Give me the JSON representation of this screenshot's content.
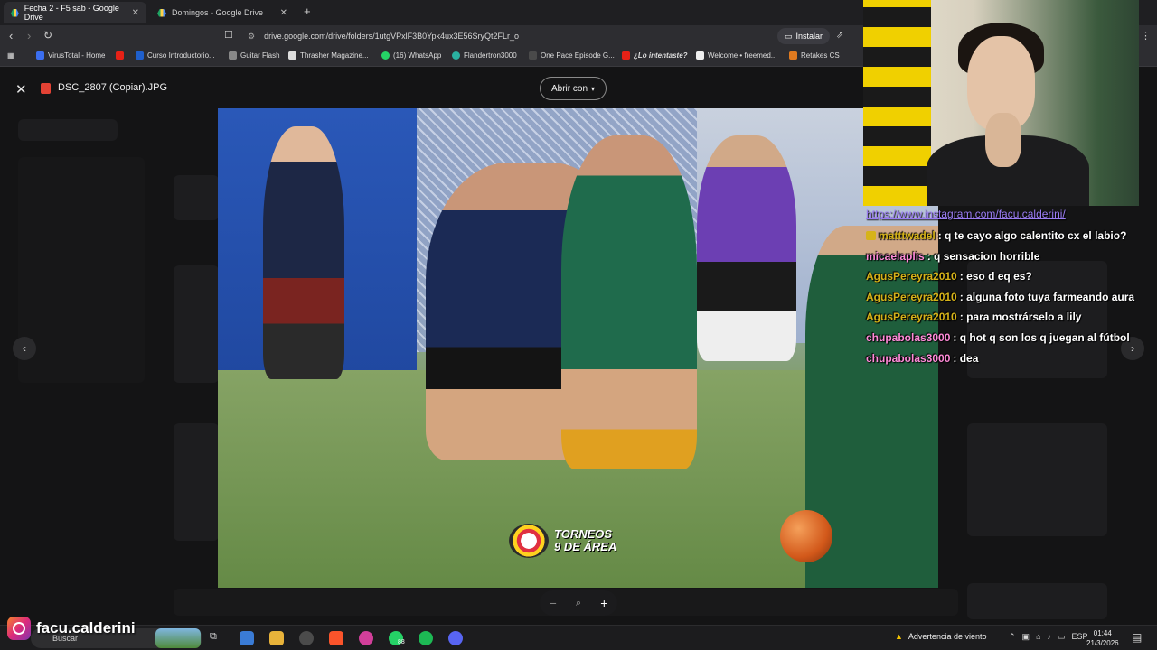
{
  "browser": {
    "tabs": [
      {
        "label": "Fecha 2 - F5 sab - Google Drive",
        "active": true
      },
      {
        "label": "Domingos - Google Drive",
        "active": false
      }
    ],
    "url": "drive.google.com/drive/folders/1utgVPxlF3B0Ypk4ux3E56SryQt2FLr_o",
    "install_label": "Instalar",
    "bookmarks": [
      "VirusTotal - Home",
      "Curso Introductorio...",
      "Guitar Flash",
      "Thrasher Magazine...",
      "(16) WhatsApp",
      "Flandertron3000",
      "One Pace Episode G...",
      "¿Lo intentaste?",
      "Welcome • freemed...",
      "Retakes CS"
    ]
  },
  "viewer": {
    "file_name": "DSC_2807 (Copiar).JPG",
    "open_with_label": "Abrir con",
    "photo_logo_text": [
      "TORNEOS",
      "9 DE ÁREA"
    ]
  },
  "chat": {
    "link": "https://www.instagram.com/facu.calderini/",
    "messages": [
      {
        "user": "matttwadel",
        "text": ": q te cayo algo calentito cx el labio?",
        "color": "#d6b319",
        "badge": true
      },
      {
        "user": "micaelaplis",
        "text": ": q sensacion horrible",
        "color": "#ff8ad8",
        "badge": false
      },
      {
        "user": "AgusPereyra2010",
        "text": ": eso d eq es?",
        "color": "#d6b319",
        "badge": false
      },
      {
        "user": "AgusPereyra2010",
        "text": ": alguna foto tuya farmeando aura",
        "color": "#d6b319",
        "badge": false
      },
      {
        "user": "AgusPereyra2010",
        "text": ": para mostrárselo a lily",
        "color": "#d6b319",
        "badge": false
      },
      {
        "user": "chupabolas3000",
        "text": ": q hot q son los q juegan al fútbol",
        "color": "#ff8ad8",
        "badge": false
      },
      {
        "user": "chupabolas3000",
        "text": ": dea",
        "color": "#ff8ad8",
        "badge": false
      }
    ]
  },
  "instagram_handle": "facu.calderini",
  "taskbar": {
    "search_placeholder": "Buscar",
    "weather_label": "Advertencia de viento",
    "language": "ESP",
    "time": "01:44",
    "date": "21/3/2026",
    "whatsapp_badge": "88"
  }
}
